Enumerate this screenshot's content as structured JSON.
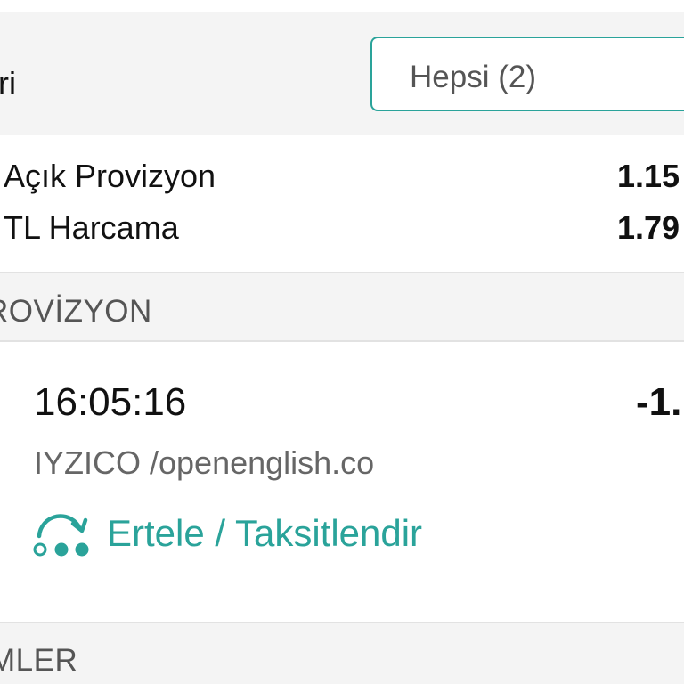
{
  "filter": {
    "label": "ri",
    "selected": "Hepsi (2)"
  },
  "summary": {
    "rows": [
      {
        "label": "Açık Provizyon",
        "value": "1.15"
      },
      {
        "label": "TL Harcama",
        "value": "1.79"
      }
    ]
  },
  "sections": {
    "provizyon_title": "ROVİZYON",
    "islemler_title": "MLER"
  },
  "transaction": {
    "time": "16:05:16",
    "amount": "-1.",
    "merchant": "IYZICO /openenglish.co",
    "action_label": "Ertele / Taksitlendir",
    "action_icon": "defer-installment-icon"
  },
  "colors": {
    "accent": "#2aa39a",
    "background": "#f4f4f4",
    "card": "#ffffff",
    "divider": "#e2e2e2",
    "secondary_text": "#666666"
  }
}
